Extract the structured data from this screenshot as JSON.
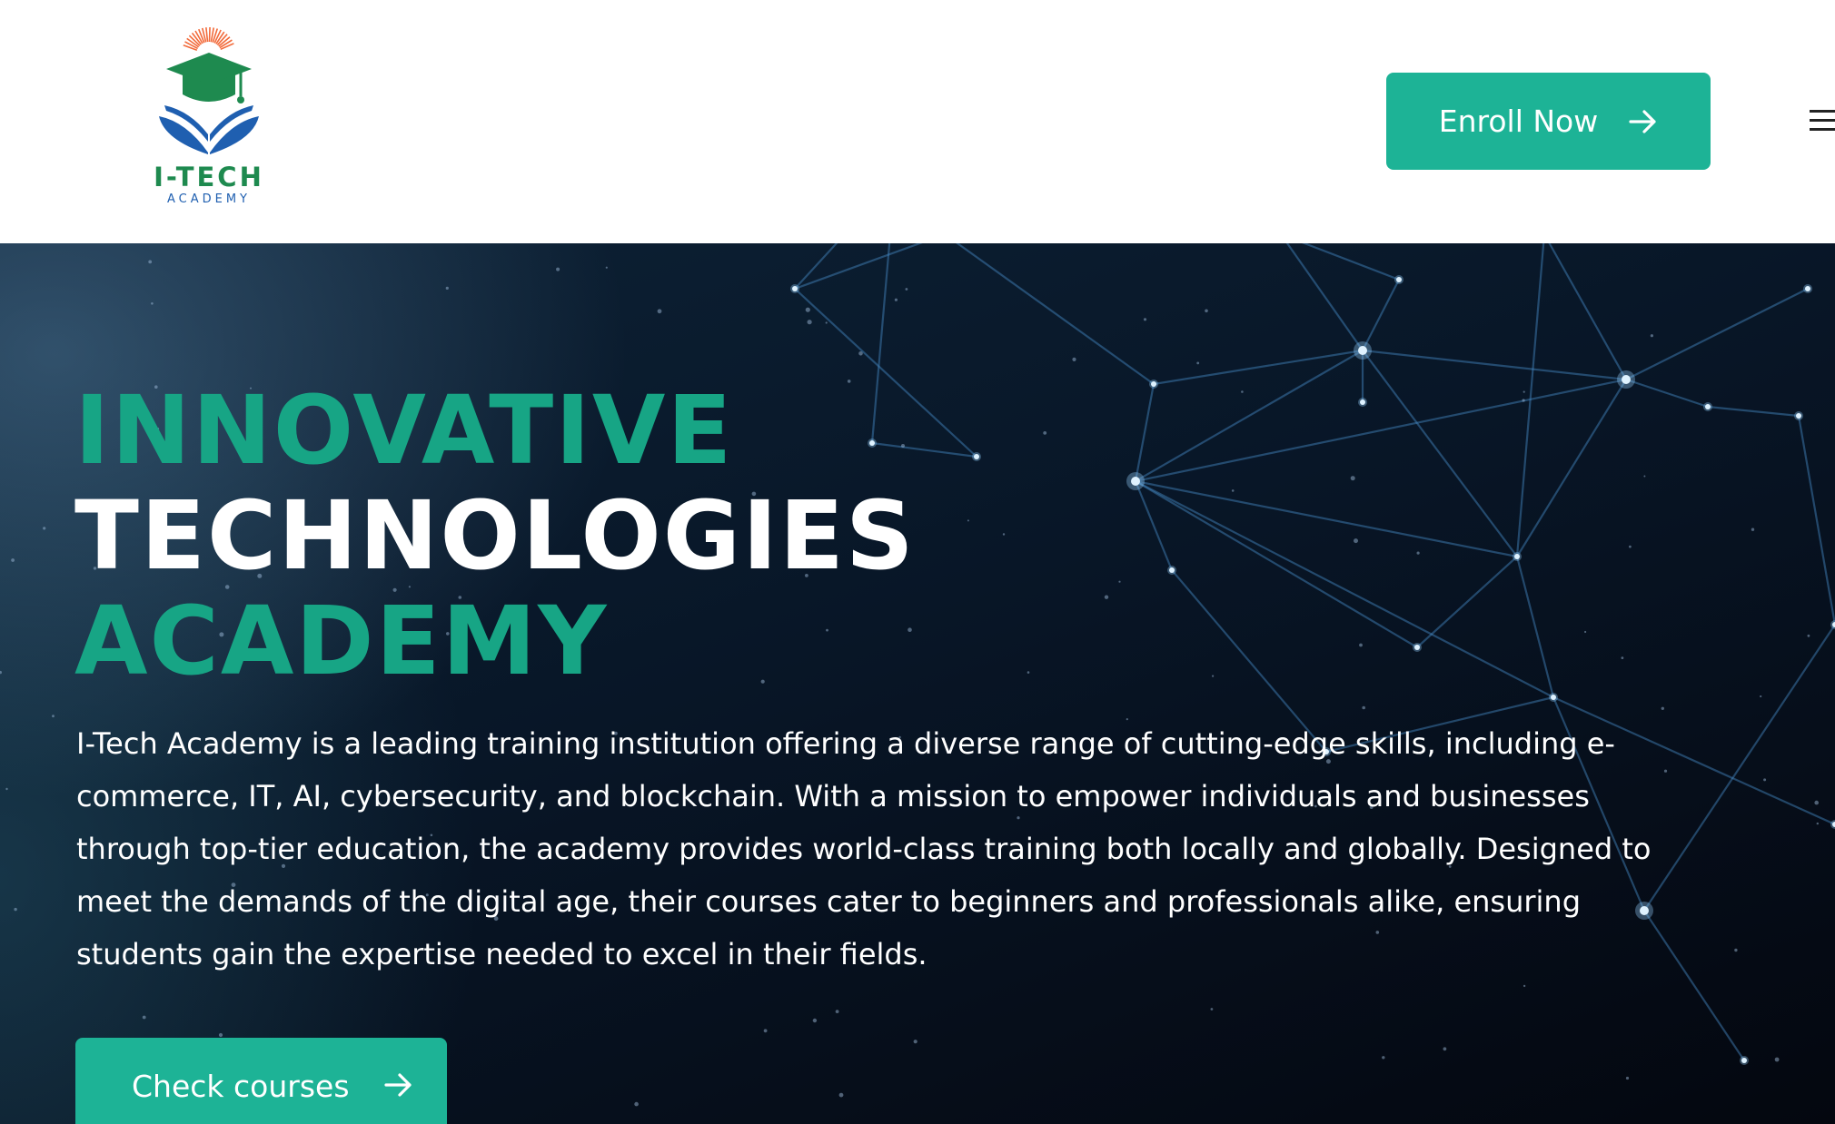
{
  "colors": {
    "accent": "#1db396",
    "headline_green": "#17a585",
    "logo_green": "#1e8a4f",
    "logo_blue": "#1f5fb0",
    "logo_sun": "#f26a3a",
    "text_white": "#ffffff"
  },
  "header": {
    "logo": {
      "title": "I-TECH",
      "subtitle": "ACADEMY",
      "icon": "graduation-cap-book-icon"
    },
    "enroll_button": {
      "label": "Enroll Now",
      "icon": "arrow-right-icon"
    },
    "menu_icon": "hamburger-menu-icon"
  },
  "hero": {
    "headline": {
      "line1": "INNOVATIVE",
      "line2": "TECHNOLOGIES",
      "line3": "ACADEMY"
    },
    "description": "I-Tech Academy is a leading training institution offering a diverse range of cutting-edge skills, including e-commerce, IT, AI, cybersecurity, and blockchain. With a mission to empower individuals and businesses through top-tier education, the academy provides world-class training both locally and globally. Designed to meet the demands of the digital age, their courses cater to beginners and professionals alike, ensuring students gain the expertise needed to excel in their fields.",
    "cta_button": {
      "label": "Check courses",
      "icon": "arrow-right-icon"
    },
    "background": "network-constellation"
  }
}
